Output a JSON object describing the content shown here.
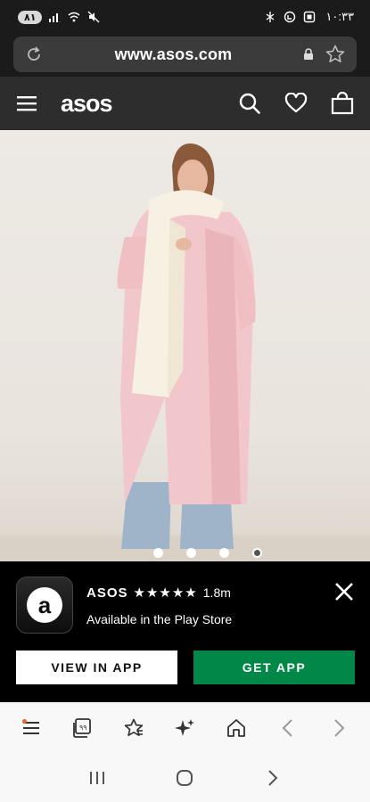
{
  "status_bar": {
    "battery": "۸۱",
    "time": "۱۰:۳۳"
  },
  "browser": {
    "url": "www.asos.com"
  },
  "site": {
    "logo": "asos"
  },
  "gallery": {
    "slide_count": 4,
    "active_slide": 4
  },
  "app_banner": {
    "app_name": "ASOS",
    "stars": "★★★★★",
    "rating_count": "1.8m",
    "subtitle": "Available in the Play Store",
    "view_in_app_label": "VIEW IN APP",
    "get_app_label": "GET APP"
  },
  "colors": {
    "get_app_green": "#018849",
    "header_bg": "#2d2d2d",
    "coat_pink": "#f2c7cb",
    "notification_orange": "#e6662e"
  },
  "icons": {
    "status": [
      "battery-icon",
      "signal-icon",
      "wifi-icon",
      "mute-icon",
      "bluetooth-icon",
      "data-saver-icon",
      "screenshot-icon"
    ],
    "header": [
      "menu-icon",
      "search-icon",
      "heart-icon",
      "bag-icon"
    ],
    "toolbar": [
      "menu-icon",
      "tabs-icon",
      "bookmark-star-icon",
      "ai-sparkle-icon",
      "home-icon",
      "back-icon",
      "forward-icon"
    ],
    "system_nav": [
      "recents-icon",
      "home-circle-icon",
      "back-chevron-icon"
    ]
  }
}
